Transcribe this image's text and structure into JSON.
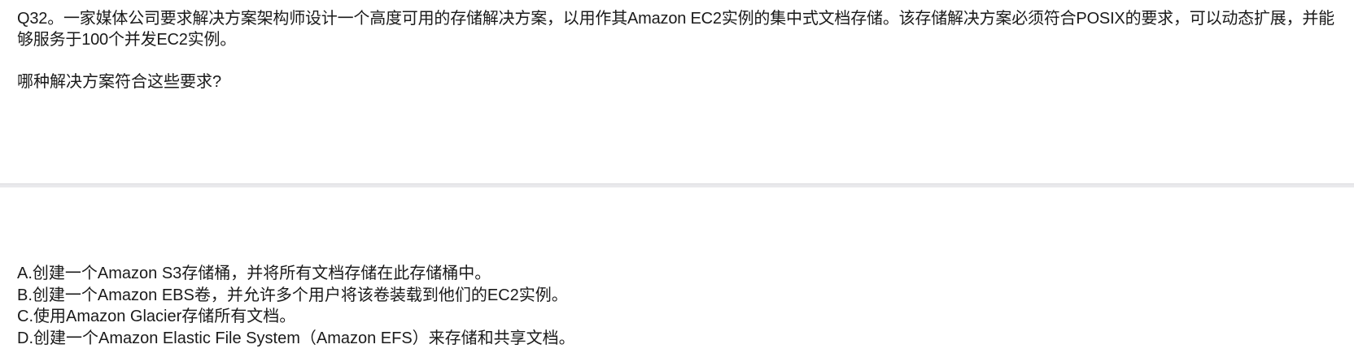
{
  "question": {
    "text": "Q32。一家媒体公司要求解决方案架构师设计一个高度可用的存储解决方案，以用作其Amazon EC2实例的集中式文档存储。该存储解决方案必须符合POSIX的要求，可以动态扩展，并能够服务于100个并发EC2实例。",
    "prompt": "哪种解决方案符合这些要求?"
  },
  "options": [
    "A.创建一个Amazon S3存储桶，并将所有文档存储在此存储桶中。",
    "B.创建一个Amazon EBS卷，并允许多个用户将该卷装载到他们的EC2实例。",
    "C.使用Amazon Glacier存储所有文档。",
    "D.创建一个Amazon Elastic File System（Amazon EFS）来存储和共享文档。"
  ]
}
